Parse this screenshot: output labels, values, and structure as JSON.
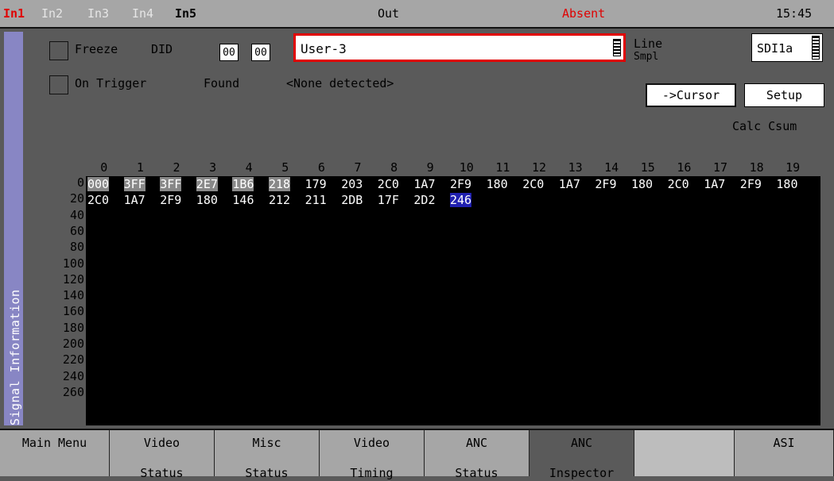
{
  "topbar": {
    "inputs": [
      "In1",
      "In2",
      "In3",
      "In4",
      "In5"
    ],
    "output_label": "Out",
    "status": "Absent",
    "clock": "15:45"
  },
  "sidebar": {
    "tab_label": "Signal Information"
  },
  "controls": {
    "freeze_label": "Freeze",
    "did_label": "DID",
    "did_value": "00",
    "sdid_value": "00",
    "user_field": "User-3",
    "on_trigger_label": "On Trigger",
    "found_label": "Found",
    "found_value": "<None detected>",
    "line_label": "Line",
    "smpl_label": "Smpl",
    "sdi_value": "SDI1a",
    "cursor_button": "->Cursor",
    "setup_button": "Setup",
    "calc_csum": "Calc Csum"
  },
  "grid": {
    "columns": [
      "0",
      "1",
      "2",
      "3",
      "4",
      "5",
      "6",
      "7",
      "8",
      "9",
      "10",
      "11",
      "12",
      "13",
      "14",
      "15",
      "16",
      "17",
      "18",
      "19"
    ],
    "row_labels": [
      "0",
      "20",
      "40",
      "60",
      "80",
      "100",
      "120",
      "140",
      "160",
      "180",
      "200",
      "220",
      "240",
      "260"
    ],
    "rows": [
      [
        "000",
        "3FF",
        "3FF",
        "2E7",
        "1B6",
        "218",
        "179",
        "203",
        "2C0",
        "1A7",
        "2F9",
        "180",
        "2C0",
        "1A7",
        "2F9",
        "180",
        "2C0",
        "1A7",
        "2F9",
        "180"
      ],
      [
        "2C0",
        "1A7",
        "2F9",
        "180",
        "146",
        "212",
        "211",
        "2DB",
        "17F",
        "2D2",
        "246"
      ]
    ],
    "highlighted_header_cells": 6,
    "selected_cell": "246"
  },
  "menu": {
    "items": [
      {
        "line1": "Main Menu",
        "line2": ""
      },
      {
        "line1": "Video",
        "line2": "Status"
      },
      {
        "line1": "Misc",
        "line2": "Status"
      },
      {
        "line1": "Video",
        "line2": "Timing"
      },
      {
        "line1": "ANC",
        "line2": "Status"
      },
      {
        "line1": "ANC",
        "line2": "Inspector"
      },
      {
        "line1": "",
        "line2": ""
      },
      {
        "line1": "ASI",
        "line2": ""
      }
    ]
  },
  "colors": {
    "accent_red": "#e00000",
    "selection_blue": "#2020b0",
    "side_tab": "#8886c4"
  }
}
